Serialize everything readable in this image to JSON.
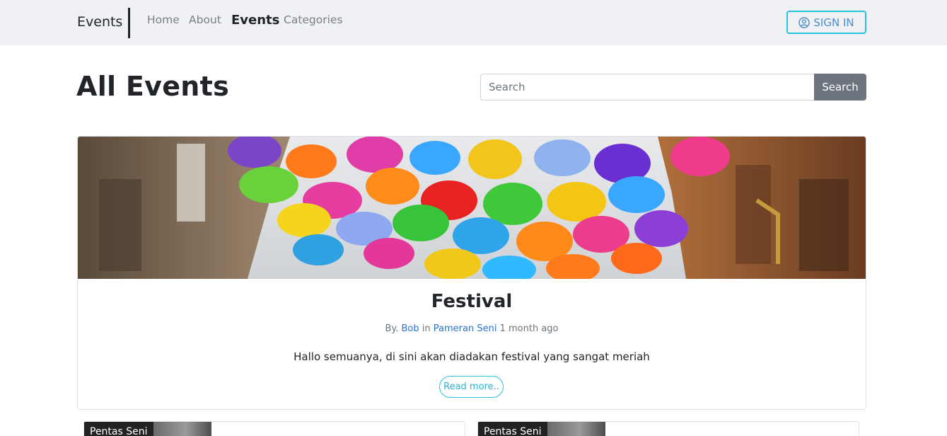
{
  "navbar": {
    "brand": "Events",
    "links": [
      {
        "label": "Home"
      },
      {
        "label": "About"
      },
      {
        "label": "Events"
      },
      {
        "label": "Categories"
      }
    ],
    "signin_label": "SIGN IN"
  },
  "header": {
    "title": "All Events",
    "search_placeholder": "Search",
    "search_button": "Search"
  },
  "featured": {
    "title": "Festival",
    "by_prefix": "By.",
    "author": "Bob",
    "in_word": "in",
    "category": "Pameran Seni",
    "time_ago": "1 month ago",
    "description": "Hallo semuanya, di sini akan diadakan festival yang sangat meriah",
    "read_more": "Read more.."
  },
  "cards": [
    {
      "category": "Pentas Seni"
    },
    {
      "category": "Pentas Seni"
    }
  ],
  "colors": {
    "navbar_bg": "#f0f1f4",
    "accent_cyan": "#27c2e2",
    "link_blue": "#2a73c9",
    "search_button_bg": "#6c757d"
  },
  "icons": {
    "signin": "user-circle-icon"
  }
}
